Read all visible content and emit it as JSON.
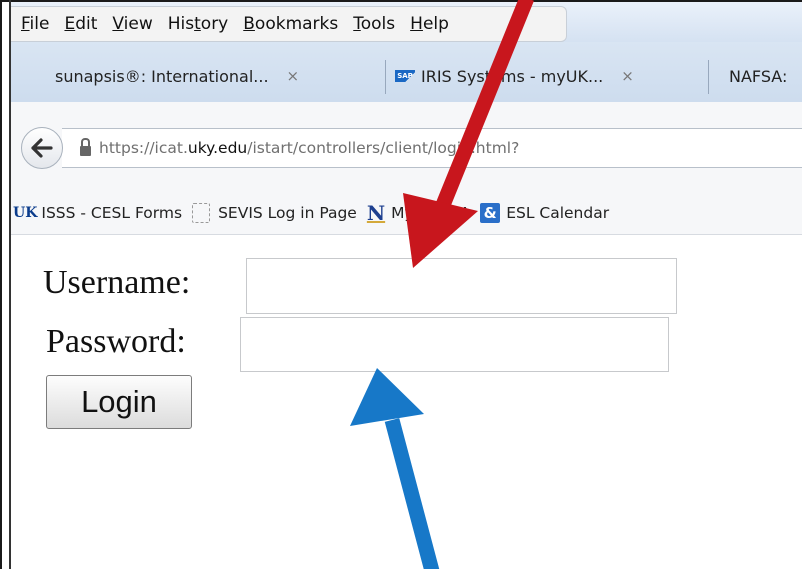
{
  "menu": {
    "items": [
      {
        "label": "File",
        "ul": "F",
        "rest": "ile"
      },
      {
        "label": "Edit",
        "ul": "E",
        "rest": "dit"
      },
      {
        "label": "View",
        "ul": "V",
        "rest": "iew"
      },
      {
        "label": "History",
        "pre": "His",
        "ul": "t",
        "rest": "ory"
      },
      {
        "label": "Bookmarks",
        "ul": "B",
        "rest": "ookmarks"
      },
      {
        "label": "Tools",
        "ul": "T",
        "rest": "ools"
      },
      {
        "label": "Help",
        "ul": "H",
        "rest": "elp"
      }
    ]
  },
  "tabs": [
    {
      "label": "sunapsis®: International...",
      "close": "×"
    },
    {
      "label": "IRIS Systems - myUK...",
      "close": "×",
      "icon": "SAP"
    },
    {
      "label": "NAFSA:"
    }
  ],
  "address": {
    "prefix": "https://icat.",
    "host": "uky.edu",
    "path": "/istart/controllers/client/login.html?"
  },
  "bookmarks": [
    {
      "icon": "UK",
      "label": "ISSS - CESL Forms"
    },
    {
      "label": "SEVIS Log in Page"
    },
    {
      "icon": "N",
      "label": "My NAFSA"
    },
    {
      "icon": "&",
      "label": "ESL Calendar"
    }
  ],
  "form": {
    "username_label": "Username:",
    "password_label": "Password:",
    "username_value": "",
    "password_value": "",
    "login_label": "Login"
  },
  "colors": {
    "arrow_red": "#c8161d",
    "arrow_blue": "#1778c8"
  }
}
